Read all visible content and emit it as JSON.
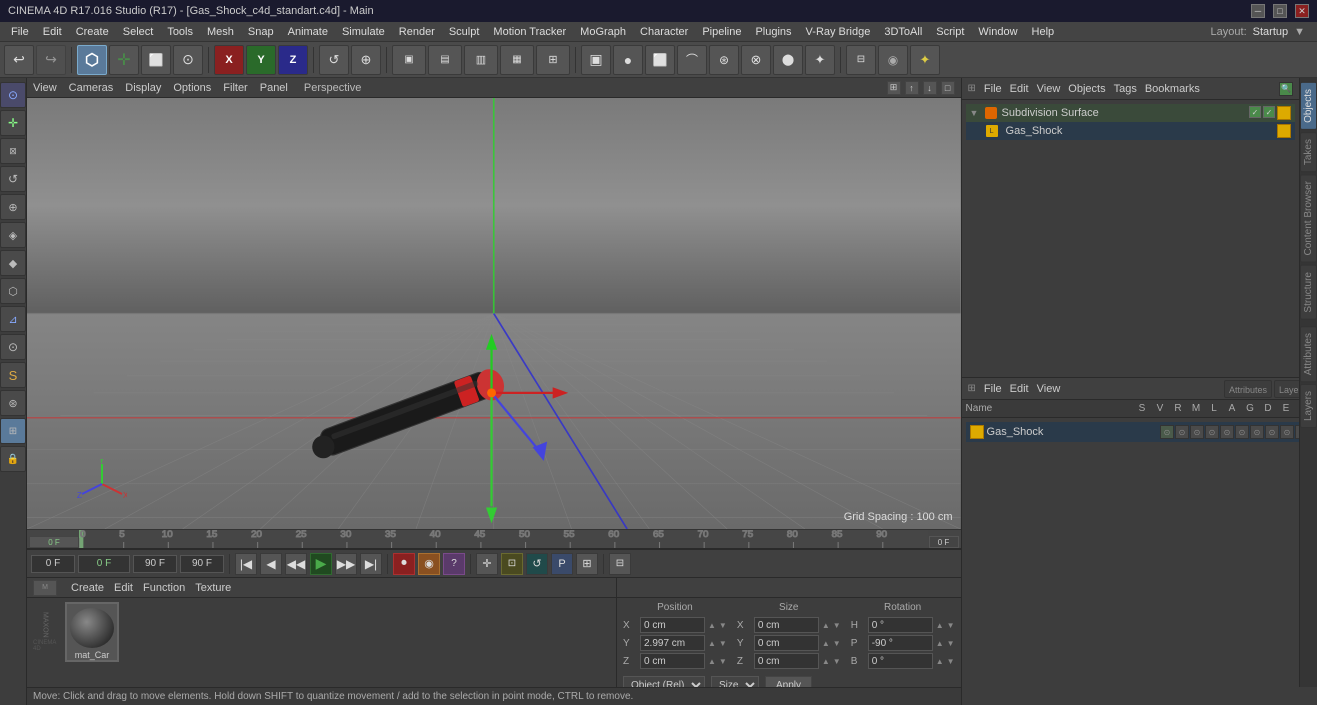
{
  "titleBar": {
    "title": "CINEMA 4D R17.016 Studio (R17) - [Gas_Shock_c4d_standart.c4d] - Main",
    "controls": [
      "─",
      "□",
      "✕"
    ]
  },
  "menuBar": {
    "items": [
      "File",
      "Edit",
      "Create",
      "Select",
      "Tools",
      "Mesh",
      "Snap",
      "Animate",
      "Simulate",
      "Render",
      "Sculpt",
      "Motion Tracker",
      "MoGraph",
      "Character",
      "Pipeline",
      "Plugins",
      "V-Ray Bridge",
      "3DToAll",
      "Script",
      "Window",
      "Help"
    ]
  },
  "layoutLabel": "Layout:",
  "layoutValue": "Startup",
  "toolbar": {
    "buttons": [
      "↩",
      "⊙",
      "↕",
      "⊕",
      "✕",
      "○",
      "↺",
      "⊕"
    ]
  },
  "viewport": {
    "menuItems": [
      "View",
      "Cameras",
      "Display",
      "Options",
      "Filter",
      "Panel"
    ],
    "label": "Perspective",
    "gridSpacing": "Grid Spacing : 100 cm"
  },
  "objects": {
    "header": [
      "File",
      "Edit",
      "View",
      "Objects",
      "Tags",
      "Bookmarks"
    ],
    "items": [
      {
        "name": "Subdivision Surface",
        "color": "#dd6600",
        "indent": 0,
        "checked": true
      },
      {
        "name": "Gas_Shock",
        "color": "#ddaa00",
        "indent": 1,
        "checked": false
      }
    ]
  },
  "attr": {
    "header": [
      "File",
      "Edit",
      "View"
    ],
    "columns": [
      "Name",
      "S",
      "V",
      "R",
      "M",
      "L",
      "A",
      "G",
      "D",
      "E",
      "X"
    ],
    "rows": [
      {
        "name": "Gas_Shock",
        "color": "#ddaa00"
      }
    ]
  },
  "tabs": {
    "right": [
      "Objects",
      "Takes",
      "Content Browser",
      "Structure",
      "Attributes",
      "Layers"
    ]
  },
  "position": {
    "title": "Position",
    "x": {
      "label": "X",
      "value": "0 cm"
    },
    "y": {
      "label": "Y",
      "value": "2.997 cm"
    },
    "z": {
      "label": "Z",
      "value": "0 cm"
    }
  },
  "size": {
    "title": "Size",
    "x": {
      "label": "X",
      "value": "0 cm"
    },
    "y": {
      "label": "Y",
      "value": "0 cm"
    },
    "z": {
      "label": "Z",
      "value": "0 cm"
    }
  },
  "rotation": {
    "title": "Rotation",
    "h": {
      "label": "H",
      "value": "0 °"
    },
    "p": {
      "label": "P",
      "value": "-90 °"
    },
    "b": {
      "label": "B",
      "value": "0 °"
    }
  },
  "coordSystem": "Object (Rel)",
  "coordMode": "Size",
  "applyBtn": "Apply",
  "material": {
    "menuItems": [
      "Create",
      "Edit",
      "Function",
      "Texture"
    ],
    "items": [
      {
        "name": "mat_Car"
      }
    ]
  },
  "timeline": {
    "startFrame": "0 F",
    "currentFrame": "0 F",
    "endFrame1": "90 F",
    "endFrame2": "90 F",
    "frameMarker": "0 F",
    "marks": [
      "0",
      "5",
      "10",
      "15",
      "20",
      "25",
      "30",
      "35",
      "40",
      "45",
      "50",
      "55",
      "60",
      "65",
      "70",
      "75",
      "80",
      "85",
      "90"
    ]
  },
  "statusBar": {
    "text": "Move: Click and drag to move elements. Hold down SHIFT to quantize movement / add to the selection in point mode, CTRL to remove."
  }
}
